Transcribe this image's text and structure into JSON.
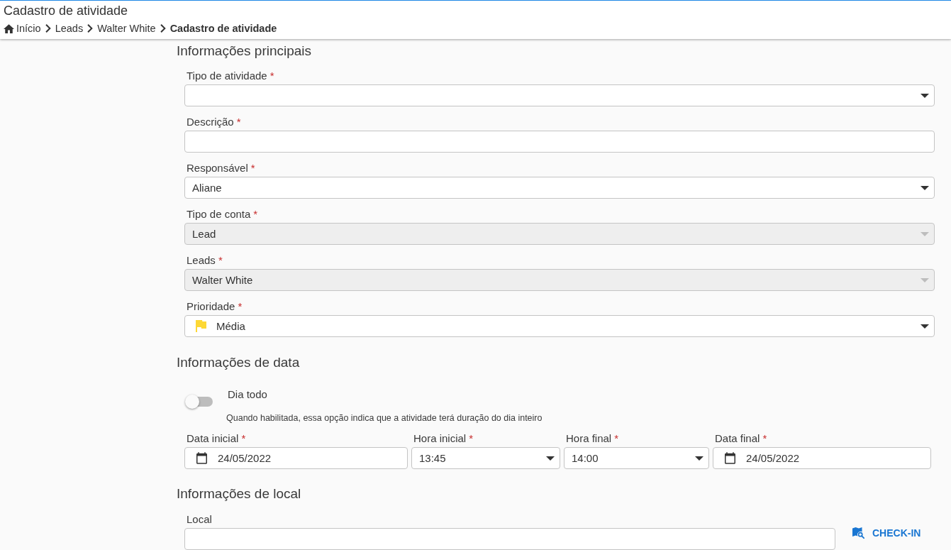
{
  "header": {
    "title": "Cadastro de atividade",
    "breadcrumb": [
      {
        "kind": "home",
        "label": "Início"
      },
      {
        "kind": "link",
        "label": "Leads"
      },
      {
        "kind": "link",
        "label": "Walter White"
      },
      {
        "kind": "current",
        "label": "Cadastro de atividade"
      }
    ]
  },
  "main_info": {
    "title": "Informações principais",
    "fields": [
      {
        "kind": "select",
        "label": "Tipo de atividade",
        "required_mark": "*",
        "disabled": false
      },
      {
        "kind": "text",
        "label": "Descrição",
        "required_mark": "*",
        "disabled": false
      },
      {
        "kind": "select",
        "label": "Responsável",
        "required_mark": "*",
        "disabled": false,
        "value": "Aliane"
      },
      {
        "kind": "select",
        "label": "Tipo de conta",
        "required_mark": "*",
        "disabled": true,
        "value": "Lead"
      },
      {
        "kind": "select",
        "label": "Leads",
        "required_mark": "*",
        "disabled": true,
        "value": "Walter White"
      },
      {
        "kind": "priority",
        "label": "Prioridade",
        "required_mark": "*",
        "disabled": false,
        "value": "Média"
      }
    ]
  },
  "date_info": {
    "title": "Informações de data",
    "all_day": {
      "label": "Dia todo",
      "on": false,
      "help": "Quando habilitada, essa opção indica que a atividade terá duração do dia inteiro"
    },
    "fields": [
      {
        "kind": "date",
        "label": "Data inicial",
        "required_mark": "*",
        "value": "24/05/2022"
      },
      {
        "kind": "time",
        "label": "Hora inicial",
        "required_mark": "*",
        "value": "13:45"
      },
      {
        "kind": "time",
        "label": "Hora final",
        "required_mark": "*",
        "value": "14:00"
      },
      {
        "kind": "date",
        "label": "Data final",
        "required_mark": "*",
        "value": "24/05/2022"
      }
    ]
  },
  "location_info": {
    "title": "Informações de local",
    "field": {
      "kind": "text",
      "label": "Local"
    },
    "check_in": {
      "label": "CHECK-IN"
    }
  }
}
